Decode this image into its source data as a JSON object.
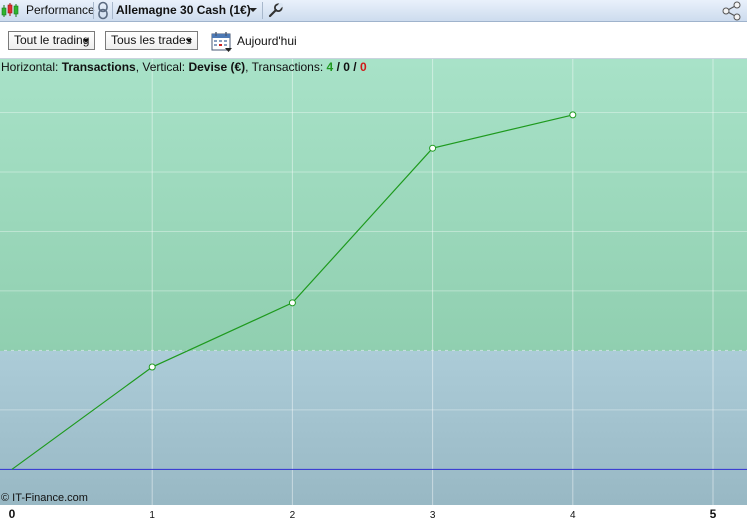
{
  "header": {
    "performance_tab": "Performance",
    "instrument": "Allemagne 30 Cash (1€)"
  },
  "toolbar": {
    "period_select": "Tout le trading",
    "trades_select": "Tous les trades",
    "today_label": "Aujourd'hui"
  },
  "info": {
    "horizontal_label": "Horizontal:",
    "horizontal_value": "Transactions",
    "vertical_label": "Vertical:",
    "vertical_value": "Devise (€)",
    "transactions_label": "Transactions:",
    "wins": "4",
    "neutral": "0",
    "losses": "0",
    "slash": "/"
  },
  "copyright": "© IT-Finance.com",
  "colors": {
    "line": "#1e9a1e",
    "baseline": "#2b2bd0",
    "profit_zone_top": "#a8e2c8",
    "profit_zone_bottom": "#90cfb0",
    "loss_zone_top": "#acccd8",
    "loss_zone_bottom": "#98b8c4",
    "win_count": "#1f9a1f",
    "loss_count": "#d01818"
  },
  "chart_data": {
    "type": "line",
    "x": [
      0,
      1,
      2,
      3,
      4
    ],
    "values": [
      0,
      0.86,
      1.4,
      2.7,
      2.98
    ],
    "xlim": [
      0,
      5
    ],
    "ylim": [
      -0.3,
      3.45
    ],
    "tick_labels": [
      "0",
      "1",
      "2",
      "3",
      "4",
      "5"
    ],
    "title": "",
    "xlabel": "Transactions",
    "ylabel": "Devise (€)",
    "grid": true
  }
}
